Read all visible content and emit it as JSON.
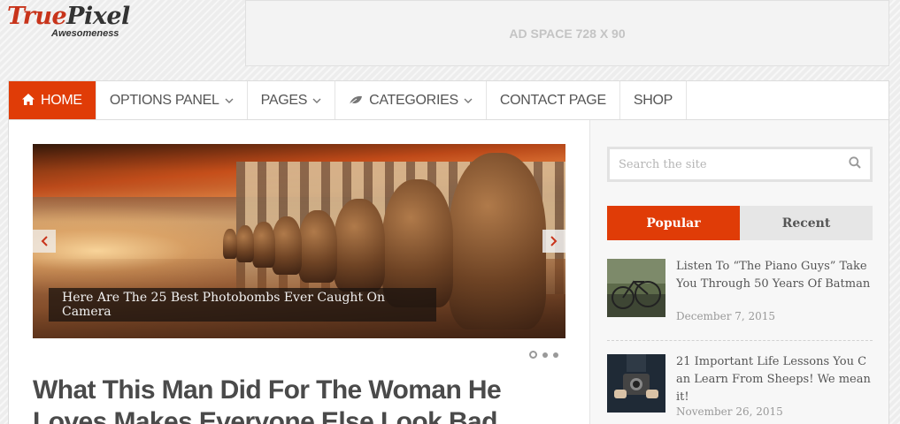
{
  "logo": {
    "part1": "True",
    "part2": "Pixel",
    "tagline": "Awesomeness"
  },
  "ad": {
    "label": "AD SPACE 728 X 90"
  },
  "nav": {
    "items": [
      {
        "label": "HOME",
        "icon": "home-icon"
      },
      {
        "label": "OPTIONS PANEL"
      },
      {
        "label": "PAGES"
      },
      {
        "label": "CATEGORIES",
        "icon": "leaf-icon"
      },
      {
        "label": "CONTACT PAGE"
      },
      {
        "label": "SHOP"
      }
    ]
  },
  "slider": {
    "caption": "Here Are The 25 Best Photobombs Ever Caught On Camera"
  },
  "post": {
    "title": "What This Man Did For The Woman He Loves Makes Everyone Else Look Bad"
  },
  "sidebar": {
    "search_placeholder": "Search the site",
    "tabs": [
      "Popular",
      "Recent"
    ],
    "posts": [
      {
        "title": "Listen To “The Piano Guys” Take You Through 50 Years Of Batman",
        "date": "December 7, 2015"
      },
      {
        "title": "21 Important Life Lessons You Can Learn From Sheeps! We mean it!",
        "date": "November 26, 2015"
      }
    ]
  },
  "colors": {
    "accent": "#e03c07",
    "logo_red": "#c8341b"
  }
}
